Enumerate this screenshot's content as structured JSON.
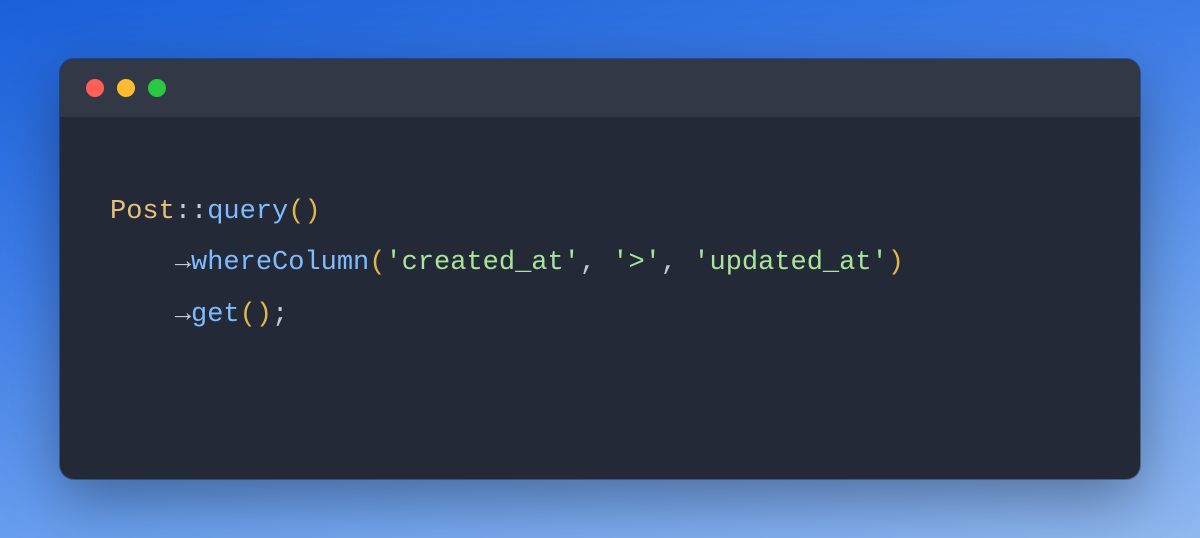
{
  "code": {
    "line1": {
      "class": "Post",
      "scope": "::",
      "func": "query",
      "open": "(",
      "close": ")"
    },
    "line2": {
      "indent": "    ",
      "arrow": "→",
      "func": "whereColumn",
      "open": "(",
      "arg1": "'created_at'",
      "sep1": ", ",
      "arg2": "'>'",
      "sep2": ", ",
      "arg3": "'updated_at'",
      "close": ")"
    },
    "line3": {
      "indent": "    ",
      "arrow": "→",
      "func": "get",
      "open": "(",
      "close": ")",
      "semi": ";"
    }
  }
}
